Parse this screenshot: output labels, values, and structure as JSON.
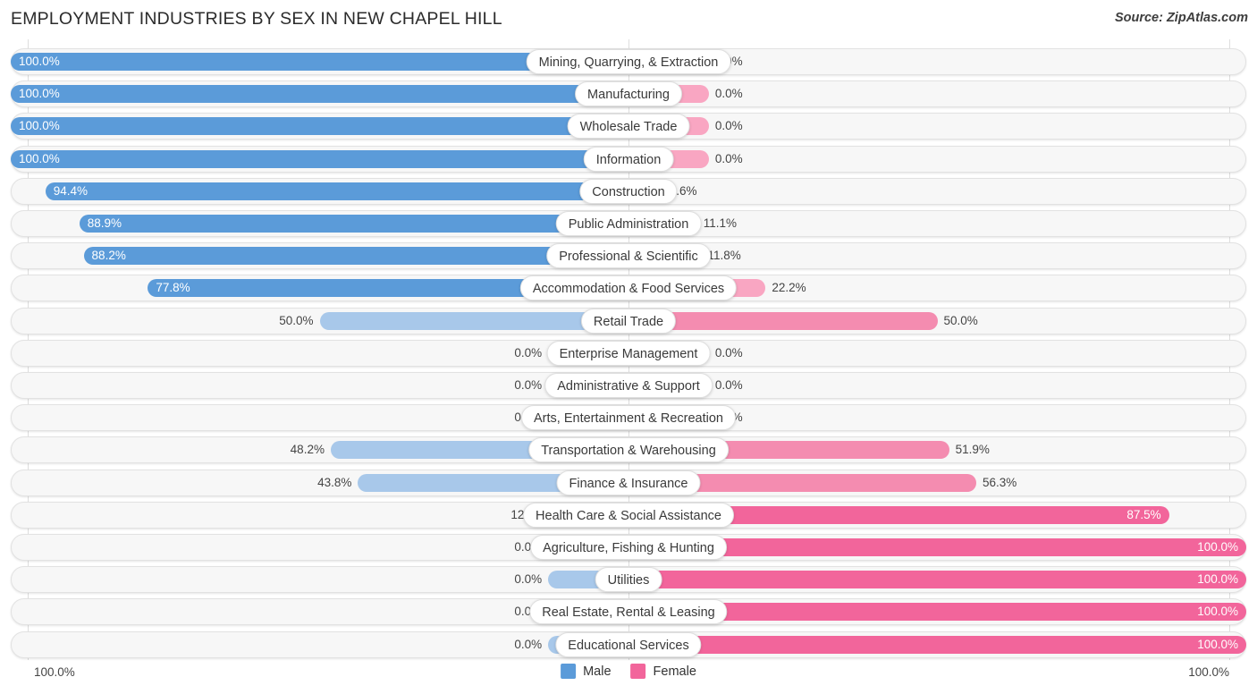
{
  "header": {
    "title": "EMPLOYMENT INDUSTRIES BY SEX IN NEW CHAPEL HILL",
    "source": "Source: ZipAtlas.com"
  },
  "footer": {
    "axis_min_left": "100.0%",
    "axis_max_right": "100.0%",
    "legend": [
      {
        "label": "Male",
        "color": "#5b9bd9"
      },
      {
        "label": "Female",
        "color": "#f2659b"
      }
    ]
  },
  "colors": {
    "male_strong": "#5b9bd9",
    "male_light": "#a8c8ea",
    "female_strong": "#f2659b",
    "female_light": "#f9a6c2",
    "track_bg": "#f7f7f7",
    "track_border": "#e2e2e2",
    "gridline": "#d8d8d8"
  },
  "chart_data": {
    "type": "bar",
    "subtype": "diverging-horizontal-100pct",
    "title": "EMPLOYMENT INDUSTRIES BY SEX IN NEW CHAPEL HILL",
    "xlabel": "",
    "ylabel": "",
    "xlim": [
      -100,
      100
    ],
    "axis_tick_labels": [
      "100.0%",
      "100.0%"
    ],
    "grid": true,
    "legend_position": "bottom-center",
    "series": [
      {
        "name": "Male",
        "color": "#5b9bd9"
      },
      {
        "name": "Female",
        "color": "#f2659b"
      }
    ],
    "categories": [
      "Mining, Quarrying, & Extraction",
      "Manufacturing",
      "Wholesale Trade",
      "Information",
      "Construction",
      "Public Administration",
      "Professional & Scientific",
      "Accommodation & Food Services",
      "Retail Trade",
      "Enterprise Management",
      "Administrative & Support",
      "Arts, Entertainment & Recreation",
      "Transportation & Warehousing",
      "Finance & Insurance",
      "Health Care & Social Assistance",
      "Agriculture, Fishing & Hunting",
      "Utilities",
      "Real Estate, Rental & Leasing",
      "Educational Services"
    ],
    "male_values": [
      100.0,
      100.0,
      100.0,
      100.0,
      94.4,
      88.9,
      88.2,
      77.8,
      50.0,
      0.0,
      0.0,
      0.0,
      48.2,
      43.8,
      12.5,
      0.0,
      0.0,
      0.0,
      0.0
    ],
    "female_values": [
      0.0,
      0.0,
      0.0,
      0.0,
      5.6,
      11.1,
      11.8,
      22.2,
      50.0,
      0.0,
      0.0,
      0.0,
      51.9,
      56.3,
      87.5,
      100.0,
      100.0,
      100.0,
      100.0
    ],
    "male_labels": [
      "100.0%",
      "100.0%",
      "100.0%",
      "100.0%",
      "94.4%",
      "88.9%",
      "88.2%",
      "77.8%",
      "50.0%",
      "0.0%",
      "0.0%",
      "0.0%",
      "48.2%",
      "43.8%",
      "12.5%",
      "0.0%",
      "0.0%",
      "0.0%",
      "0.0%"
    ],
    "female_labels": [
      "0.0%",
      "0.0%",
      "0.0%",
      "0.0%",
      "5.6%",
      "11.1%",
      "11.8%",
      "22.2%",
      "50.0%",
      "0.0%",
      "0.0%",
      "0.0%",
      "51.9%",
      "56.3%",
      "87.5%",
      "100.0%",
      "100.0%",
      "100.0%",
      "100.0%"
    ]
  }
}
